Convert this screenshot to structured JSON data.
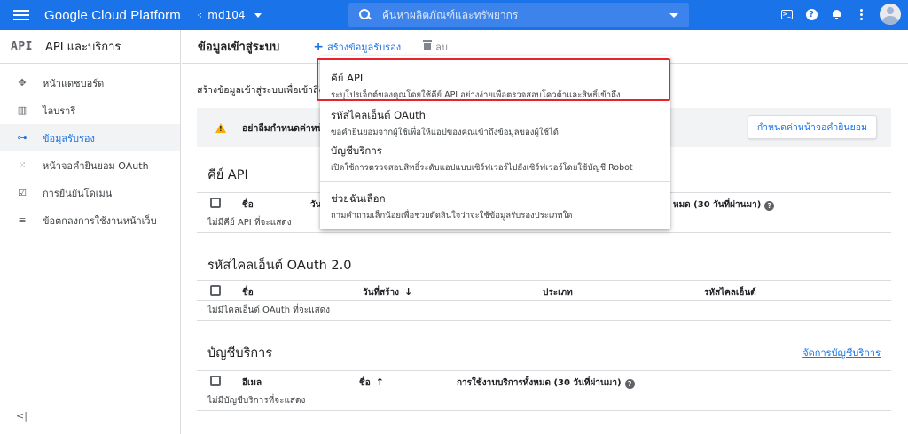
{
  "header": {
    "brand": "Google Cloud Platform",
    "project": "md104",
    "search_placeholder": "ค้นหาผลิตภัณฑ์และทรัพยากร",
    "cloudshell_glyph": ">_",
    "help_glyph": "?"
  },
  "sidebar": {
    "logo": "API",
    "title": "API และบริการ",
    "items": [
      {
        "label": "หน้าแดชบอร์ด",
        "icon": "dashboard-icon"
      },
      {
        "label": "ไลบรารี",
        "icon": "library-icon"
      },
      {
        "label": "ข้อมูลรับรอง",
        "icon": "key-icon"
      },
      {
        "label": "หน้าจอคํายินยอม OAuth",
        "icon": "consent-icon"
      },
      {
        "label": "การยืนยันโดเมน",
        "icon": "checkbox-icon"
      },
      {
        "label": "ข้อตกลงการใช้งานหน้าเว็บ",
        "icon": "settings-list-icon"
      }
    ],
    "active_index": 2,
    "collapse_glyph": "<|"
  },
  "toolbar": {
    "title": "ข้อมูลเข้าสู่ระบบ",
    "create_label": "สร้างข้อมูลรับรอง",
    "delete_label": "ลบ"
  },
  "main": {
    "intro": "สร้างข้อมูลเข้าสู่ระบบเพื่อเข้าถึง",
    "warning": "อย่าลืมกําหนดค่าหน้าจอ",
    "consent_button": "กําหนดค่าหน้าจอคํายินยอม",
    "api_keys": {
      "title": "คีย์ API",
      "columns": [
        "ชื่อ",
        "วัน",
        "หมด (30 วันที่ผ่านมา)"
      ],
      "empty": "ไม่มีคีย์ API ที่จะแสดง"
    },
    "oauth": {
      "title": "รหัสไคลเอ็นต์ OAuth 2.0",
      "columns": [
        "ชื่อ",
        "วันที่สร้าง",
        "ประเภท",
        "รหัสไคลเอ็นต์"
      ],
      "empty": "ไม่มีไคลเอ็นต์ OAuth ที่จะแสดง"
    },
    "service_accounts": {
      "title": "บัญชีบริการ",
      "manage_link": "จัดการบัญชีบริการ",
      "columns": [
        "อีเมล",
        "ชื่อ",
        "การใช้งานบริการทั้งหมด (30 วันที่ผ่านมา)"
      ],
      "empty": "ไม่มีบัญชีบริการที่จะแสดง"
    }
  },
  "dropdown": {
    "items": [
      {
        "title": "คีย์ API",
        "desc": "ระบุโปรเจ็กต์ของคุณโดยใช้คีย์ API อย่างง่ายเพื่อตรวจสอบโควต้าและสิทธิ์เข้าถึง"
      },
      {
        "title": "รหัสไคลเอ็นต์ OAuth",
        "desc": "ขอคํายินยอมจากผู้ใช้เพื่อให้แอปของคุณเข้าถึงข้อมูลของผู้ใช้ได้"
      },
      {
        "title": "บัญชีบริการ",
        "desc": "เปิดใช้การตรวจสอบสิทธิ์ระดับแอปแบบเซิร์ฟเวอร์ไปยังเซิร์ฟเวอร์โดยใช้บัญชี Robot"
      },
      {
        "title": "ช่วยฉันเลือก",
        "desc": "ถามคําถามเล็กน้อยเพื่อช่วยตัดสินใจว่าจะใช้ข้อมูลรับรองประเภทใด"
      }
    ],
    "highlight_color": "#e8232b"
  },
  "colors": {
    "brand_blue": "#1a73e8",
    "warning": "#f9ab00"
  }
}
